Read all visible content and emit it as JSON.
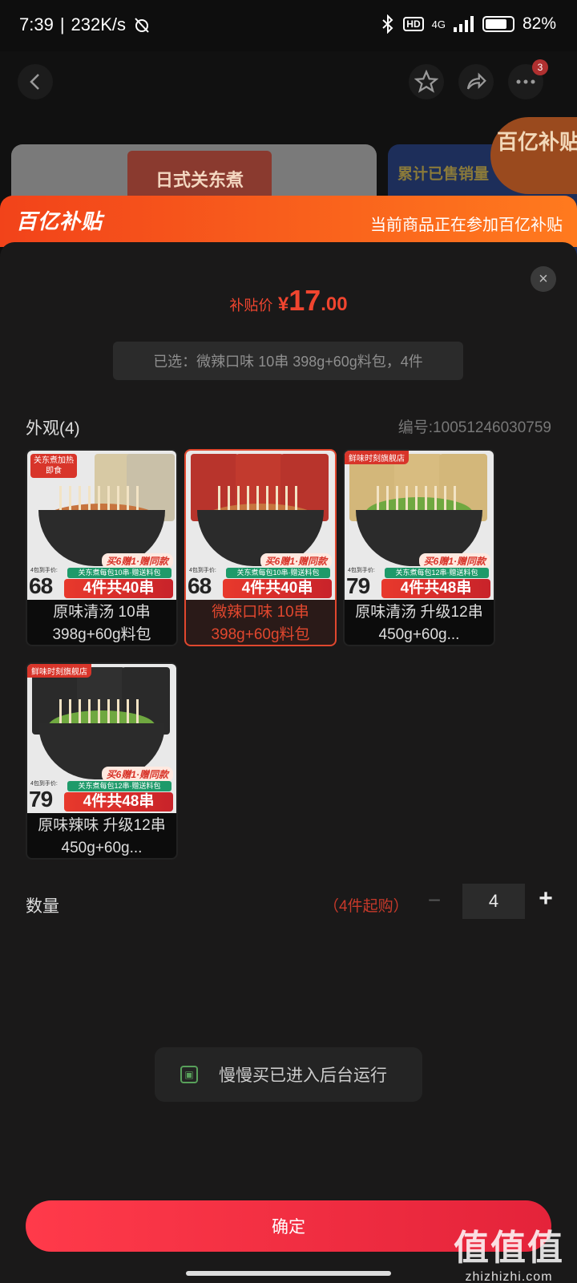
{
  "status_bar": {
    "time": "7:39",
    "net_speed": "232K/s",
    "network": "4G",
    "hd": "HD",
    "battery_text": "82%",
    "battery_level": 0.82
  },
  "background": {
    "cart_badge": "3",
    "hero_pack_text": "日式关东煮",
    "side_card_text": "累计已售销量",
    "promo_badge": "百亿补贴"
  },
  "banner": {
    "logo": "百亿补贴",
    "tip": "当前商品正在参加百亿补贴"
  },
  "sheet": {
    "close_icon": "×",
    "price_label": "补贴价",
    "price_symbol": "¥",
    "price_int": "17",
    "price_dec": ".00",
    "selected_text": "已选：微辣口味 10串 398g+60g料包，4件",
    "section_title": "外观(4)",
    "sku_code": "编号:10051246030759",
    "options": [
      {
        "name": "原味清汤 10串 398g+60g料包",
        "corner_tag": "关东煮加热即食",
        "promo": "买6赠1·赠同款",
        "unit_label": "4包到手价:",
        "unit_price": "68",
        "green_tag": "关东煮每包10串·赠送料包",
        "red_tag": "4件共40串",
        "selected": false
      },
      {
        "name": "微辣口味 10串 398g+60g料包",
        "corner_tag": "",
        "promo": "买6赠1·赠同款",
        "unit_label": "4包到手价:",
        "unit_price": "68",
        "green_tag": "关东煮每包10串·赠送料包",
        "red_tag": "4件共40串",
        "selected": true
      },
      {
        "name": "原味清汤 升级12串 450g+60g...",
        "corner_tag": "鲜味时刻旗舰店",
        "promo": "买6赠1·赠同款",
        "unit_label": "4包到手价:",
        "unit_price": "79",
        "green_tag": "关东煮每包12串·赠送料包",
        "red_tag": "4件共48串",
        "selected": false
      },
      {
        "name": "原味辣味 升级12串 450g+60g...",
        "corner_tag": "鲜味时刻旗舰店",
        "promo": "买6赠1·赠同款",
        "unit_label": "4包到手价:",
        "unit_price": "79",
        "green_tag": "关东煮每包12串·赠送料包",
        "red_tag": "4件共48串",
        "selected": false
      }
    ],
    "quantity_label": "数量",
    "min_purchase": "（4件起购）",
    "minus": "−",
    "quantity": "4",
    "plus": "+",
    "toast": "慢慢买已进入后台运行",
    "confirm": "确定"
  },
  "watermark": {
    "line1": "值值值",
    "line2": "zhizhizhi.com"
  }
}
